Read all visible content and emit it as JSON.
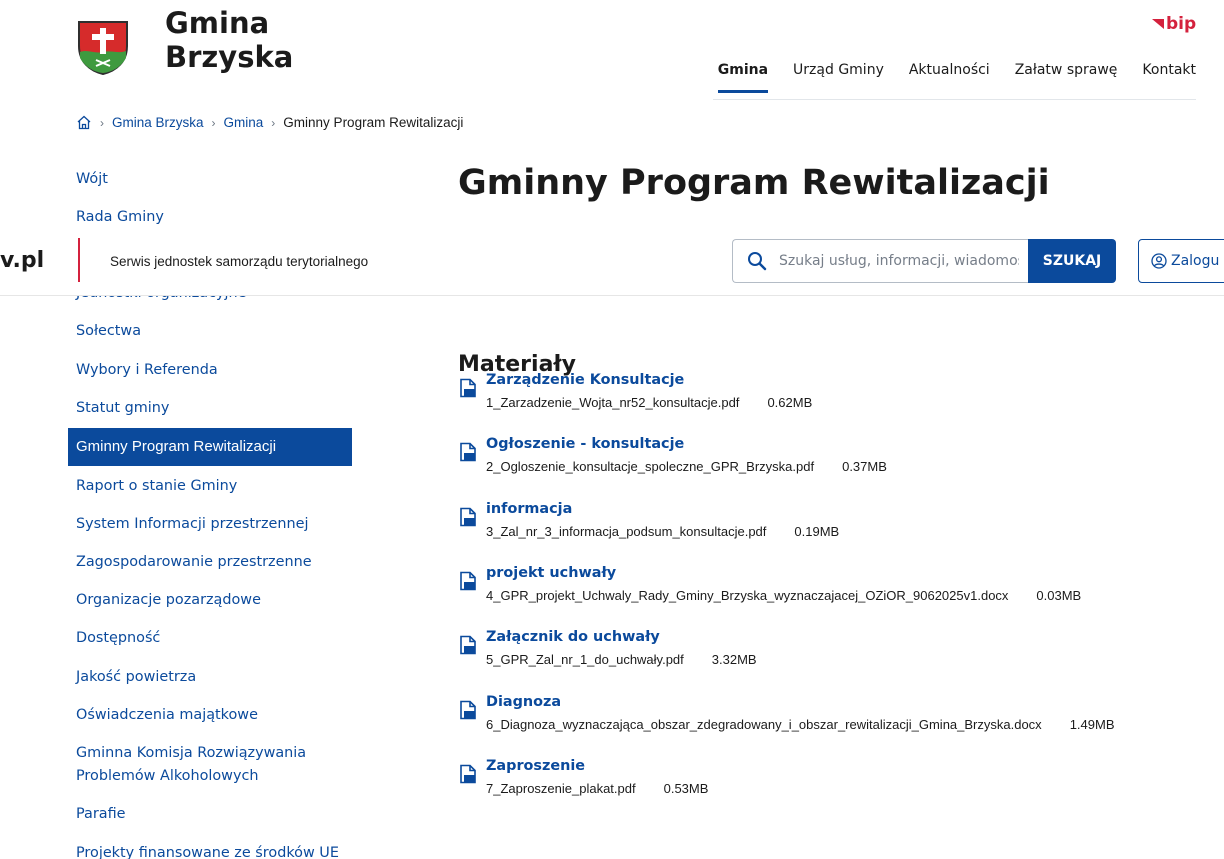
{
  "header": {
    "title_line1": "Gmina",
    "title_line2": "Brzyska",
    "bip_label": "bip",
    "nav": [
      {
        "label": "Gmina",
        "active": true
      },
      {
        "label": "Urząd Gminy",
        "active": false
      },
      {
        "label": "Aktualności",
        "active": false
      },
      {
        "label": "Załatw sprawę",
        "active": false
      },
      {
        "label": "Kontakt",
        "active": false
      }
    ]
  },
  "breadcrumb": {
    "items": [
      "Gmina Brzyska",
      "Gmina"
    ],
    "current": "Gminny Program Rewitalizacji"
  },
  "sidebar": {
    "items": [
      {
        "label": "Wójt"
      },
      {
        "label": "Rada Gminy"
      },
      {
        "label": "Jednostki organizacyjne"
      },
      {
        "label": "Sołectwa"
      },
      {
        "label": "Wybory i Referenda"
      },
      {
        "label": "Statut gminy"
      },
      {
        "label": "Gminny Program Rewitalizacji",
        "active": true
      },
      {
        "label": "Raport o stanie Gminy"
      },
      {
        "label": "System Informacji przestrzennej"
      },
      {
        "label": "Zagospodarowanie przestrzenne"
      },
      {
        "label": "Organizacje pozarządowe"
      },
      {
        "label": "Dostępność"
      },
      {
        "label": "Jakość powietrza"
      },
      {
        "label": "Oświadczenia majątkowe"
      },
      {
        "label": "Gminna Komisja Rozwiązywania Problemów Alkoholowych"
      },
      {
        "label": "Parafie"
      },
      {
        "label": "Projekty finansowane ze środków UE"
      }
    ]
  },
  "page": {
    "title": "Gminny Program Rewitalizacji"
  },
  "overlay": {
    "logo_text": "v.pl",
    "tagline": "Serwis jednostek samorządu terytorialnego",
    "search_placeholder": "Szukaj usług, informacji, wiadomości",
    "search_button": "SZUKAJ",
    "login_label": "Zalogu"
  },
  "materials": {
    "heading": "Materiały",
    "items": [
      {
        "title": "Zarządzenie Konsultacje",
        "file": "1_Zarzadzenie_Wojta_nr52_konsultacje.pdf",
        "size": "0.62MB"
      },
      {
        "title": "Ogłoszenie - konsultacje",
        "file": "2_Ogloszenie_konsultacje_spoleczne_GPR_Brzyska.pdf",
        "size": "0.37MB"
      },
      {
        "title": "informacja",
        "file": "3_Zal_nr_3_informacja_podsum_konsultacje.pdf",
        "size": "0.19MB"
      },
      {
        "title": "projekt uchwały",
        "file": "4_GPR_projekt_Uchwaly_Rady_Gminy_Brzyska_wyznaczajacej_OZiOR_9062025v1.docx",
        "size": "0.03MB"
      },
      {
        "title": "Załącznik do uchwały",
        "file": "5_GPR_Zal_nr_1_do_uchwały.pdf",
        "size": "3.32MB"
      },
      {
        "title": "Diagnoza",
        "file": "6_Diagnoza_wyznaczająca_obszar_zdegradowany_i_obszar_rewitalizacji_Gmina_Brzyska.docx",
        "size": "1.49MB"
      },
      {
        "title": "Zaproszenie",
        "file": "7_Zaproszenie_plakat.pdf",
        "size": "0.53MB"
      }
    ]
  },
  "icons": {
    "home": "home-icon",
    "chevron": "chevron-right-icon",
    "search": "search-icon",
    "user": "user-icon",
    "file": "file-icon",
    "coat_of_arms": "coat-of-arms-logo"
  },
  "colors": {
    "accent": "#0b4a9c",
    "brand_red": "#d4213d",
    "text": "#1b1b1b"
  }
}
